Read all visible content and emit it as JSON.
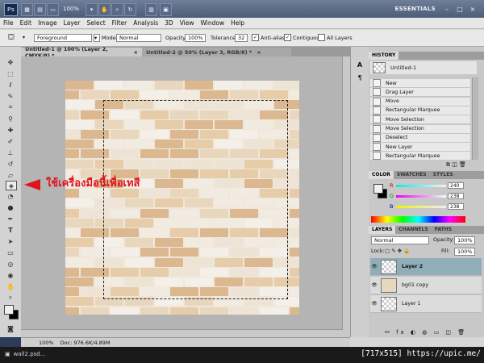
{
  "app": {
    "logo": "Ps",
    "zoom": "100%",
    "workspace": "ESSENTIALS",
    "window_buttons": [
      "–",
      "□",
      "×"
    ]
  },
  "menu": [
    "File",
    "Edit",
    "Image",
    "Layer",
    "Select",
    "Filter",
    "Analysis",
    "3D",
    "View",
    "Window",
    "Help"
  ],
  "options": {
    "fill_source": "Foreground",
    "mode_label": "Mode:",
    "mode_value": "Normal",
    "opacity_label": "Opacity:",
    "opacity_value": "100%",
    "tolerance_label": "Tolerance:",
    "tolerance_value": "32",
    "antialias": "Anti-alias",
    "contiguous": "Contiguous",
    "all_layers": "All Layers"
  },
  "tabs": [
    {
      "label": "Untitled-1 @ 100% (Layer 2, CMYK/8) *",
      "close": "×"
    },
    {
      "label": "Untitled-2 @ 50% (Layer 3, RGB/8) *",
      "close": "×"
    }
  ],
  "annotation": "ใช้เครื่องมือนี้เพื่อเทสี",
  "status": {
    "zoom": "100%",
    "doc_info": "Doc: 976.6K/4.89M"
  },
  "history": {
    "tab": "HISTORY",
    "snapshot": "Untitled-1",
    "items": [
      "New",
      "Drag Layer",
      "Move",
      "Rectangular Marquee",
      "Move Selection",
      "Move Selection",
      "Deselect",
      "New Layer",
      "Rectangular Marquee"
    ]
  },
  "color": {
    "tabs": [
      "COLOR",
      "SWATCHES",
      "STYLES"
    ],
    "r_label": "R",
    "r_value": "240",
    "g_label": "G",
    "g_value": "238",
    "b_label": "B",
    "b_value": "238",
    "foreground": "#f0eeee",
    "background": "#000000"
  },
  "layers": {
    "tabs": [
      "LAYERS",
      "CHANNELS",
      "PATHS"
    ],
    "blend_mode": "Normal",
    "opacity_label": "Opacity:",
    "opacity_value": "100%",
    "lock_label": "Lock:",
    "fill_label": "Fill:",
    "fill_value": "100%",
    "items": [
      "Layer 2",
      "bg01 copy",
      "Layer 1"
    ]
  },
  "taskbar": {
    "file": "wall2.psd..."
  },
  "watermark": "[717x515] https://upic.me/"
}
